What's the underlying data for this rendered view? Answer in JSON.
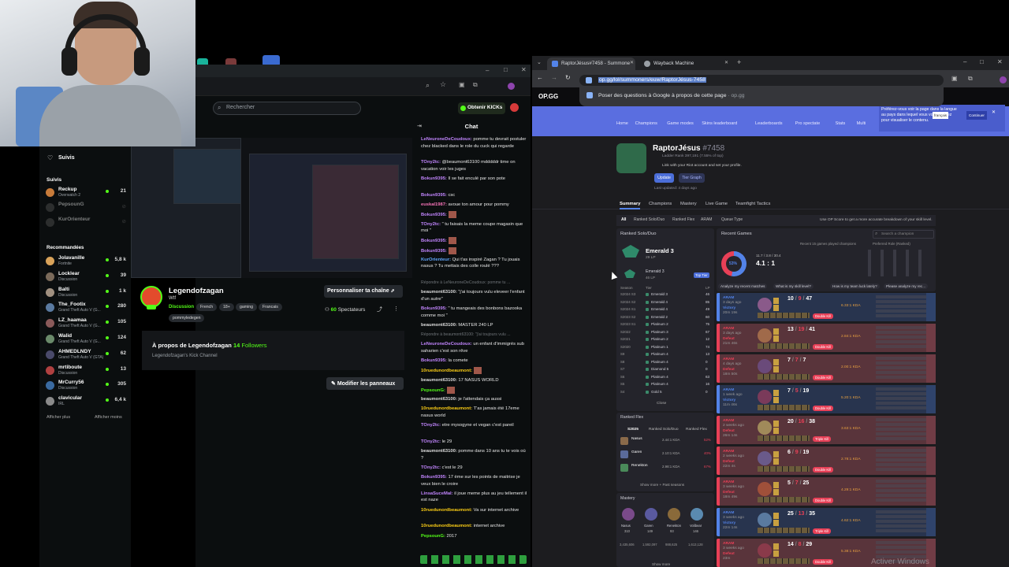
{
  "kick": {
    "search_placeholder": "Rechercher",
    "obtain_label": "Obtenir KICKs",
    "sidebar": {
      "following_title": "Suivis",
      "following_section": "Suivis",
      "following": [
        {
          "name": "Reckup",
          "sub": "Overwatch 2",
          "count": "21",
          "color": "#c77b3a"
        },
        {
          "name": "PepsounG",
          "sub": "",
          "count": "",
          "color": "#555"
        },
        {
          "name": "KurOrienteur",
          "sub": "",
          "count": "",
          "color": "#555"
        }
      ],
      "recommended_title": "Recommandées",
      "recommended": [
        {
          "name": "Jolavanille",
          "sub": "Fortnite",
          "count": "5,8 k",
          "color": "#d9a35a"
        },
        {
          "name": "Locklear",
          "sub": "Discussion",
          "count": "39",
          "color": "#7a6a5a"
        },
        {
          "name": "Balti",
          "sub": "Discussion",
          "count": "1 k",
          "color": "#a09080"
        },
        {
          "name": "The_Footix",
          "sub": "Grand Theft Auto V (G...",
          "count": "280",
          "color": "#5a7aa0"
        },
        {
          "name": "LZ_haamaa",
          "sub": "Grand Theft Auto V (G...",
          "count": "105",
          "color": "#8a5a5a"
        },
        {
          "name": "Walid",
          "sub": "Grand Theft Auto V (G...",
          "count": "124",
          "color": "#6a8a6a"
        },
        {
          "name": "AHMEDLNDY",
          "sub": "Grand Theft Auto V (GTA)",
          "count": "62",
          "color": "#4a4a6a"
        },
        {
          "name": "mrtiboute",
          "sub": "Discussion",
          "count": "13",
          "color": "#b04040"
        },
        {
          "name": "MrCurry56",
          "sub": "Discussion",
          "count": "305",
          "color": "#3a6aa0"
        },
        {
          "name": "clavicular",
          "sub": "IRL",
          "count": "6,4 k",
          "color": "#8a8a8a"
        }
      ],
      "show_more": "Afficher plus",
      "show_less": "Afficher moins"
    },
    "streamer": {
      "name": "Legendofzagan",
      "title": "Wtf",
      "category": "Discussion",
      "tags": [
        "French",
        "18+",
        "gaming",
        "Francais",
        "pommyledegen"
      ],
      "customize": "Personnaliser ta chaîne",
      "viewers": "60",
      "viewers_label": "Spectateurs",
      "about_prefix": "À propos de Legendofzagan",
      "followers": "14",
      "followers_label": "Followers",
      "channel_desc": "Legendofzagan's Kick Channel",
      "edit_panels": "Modifier les panneaux"
    },
    "chat": {
      "title": "Chat",
      "messages": [
        {
          "user": "LeNeuroneDeCoudoux:",
          "color": "#c084fc",
          "text": " pomme tu devrait postuler chez blacked dans le role du cuck qui regarde"
        },
        {
          "user": "TOny2tc:",
          "color": "#c084fc",
          "text": " @beaumont63100 mdddddr time on vacation voir les juges"
        },
        {
          "user": "Bokun9395:",
          "color": "#c084fc",
          "text": " Il se fait enculé par son pote"
        },
        {
          "user": "Bokun9395:",
          "color": "#c084fc",
          "text": " csc"
        },
        {
          "user": "euskal1987:",
          "color": "#f472b6",
          "text": " avoue ton amour pour pommy"
        },
        {
          "user": "Bokun9395:",
          "color": "#c084fc",
          "text": ""
        },
        {
          "user": "TOny2tc:",
          "color": "#c084fc",
          "text": " \" tu faisais la meme coupe magasin que moi \""
        },
        {
          "user": "Bokun9395:",
          "color": "#c084fc",
          "text": ""
        },
        {
          "user": "Bokun9395:",
          "color": "#c084fc",
          "text": ""
        },
        {
          "user": "KurOrienteur:",
          "color": "#60a5fa",
          "text": " Qui t'as inspiré Zagan ? Tu jouais nasus ? Tu mettais des colle roulé ???"
        },
        {
          "user": "",
          "color": "#6f7479",
          "text": "Répondre à LeNeuroneDeCoudoux: pomme tu ...",
          "reply": true
        },
        {
          "user": "beaumont63100:",
          "color": "#dddddd",
          "text": " \"j'ai toujours vulu eleveer l'enfant d'un autre\""
        },
        {
          "user": "Bokun9395:",
          "color": "#c084fc",
          "text": " \" tu mangeais des bonbons bazooka comme moi \""
        },
        {
          "user": "beaumont63100:",
          "color": "#dddddd",
          "text": " MASTER 240 LP"
        },
        {
          "user": "",
          "color": "#6f7479",
          "text": "Répondre à beaumont63100: \"j'ai toujours vulu ...",
          "reply": true
        },
        {
          "user": "LeNeuroneDeCoudoux:",
          "color": "#c084fc",
          "text": " un enfant d'immigrés sub saharien c'est son rêve"
        },
        {
          "user": "Bokun9395:",
          "color": "#c084fc",
          "text": " la comete"
        },
        {
          "user": "10ruedunordbeaumont:",
          "color": "#facc15",
          "text": ""
        },
        {
          "user": "beaumont63100:",
          "color": "#dddddd",
          "text": " 17 NASUS WORLD"
        },
        {
          "user": "PepsounG:",
          "color": "#53fc18",
          "text": ""
        },
        {
          "user": "beaumont63100:",
          "color": "#dddddd",
          "text": " je l'attendais ça aussi"
        },
        {
          "user": "10ruedunordbeaumont:",
          "color": "#facc15",
          "text": " T'as jamais été 17eme nasus world"
        },
        {
          "user": "TOny2tc:",
          "color": "#c084fc",
          "text": " etre mysogyne et vegan c'est pareil"
        },
        {
          "user": "TOny2tc:",
          "color": "#c084fc",
          "text": " le 29"
        },
        {
          "user": "beaumont63100:",
          "color": "#dddddd",
          "text": " pomme dans 10 ans tu te vois où ?"
        },
        {
          "user": "TOny2tc:",
          "color": "#c084fc",
          "text": " c'est le 29"
        },
        {
          "user": "Bokun9395:",
          "color": "#c084fc",
          "text": " 17 ème sur les points de maitrise je veux bien le croire"
        },
        {
          "user": "LinsaSuceMal:",
          "color": "#c084fc",
          "text": " il joue meme plus au jeu tellement il est naze"
        },
        {
          "user": "10ruedunordbeaumont:",
          "color": "#facc15",
          "text": " Va sur internet archive"
        },
        {
          "user": "10ruedunordbeaumont:",
          "color": "#facc15",
          "text": " internet archive"
        },
        {
          "user": "PepsounG:",
          "color": "#53fc18",
          "text": " 2017"
        }
      ]
    }
  },
  "browser": {
    "tabs": [
      {
        "label": "RaptorJésus#7458 - Summone",
        "active": true,
        "color": "#5383e8"
      },
      {
        "label": "Wayback Machine",
        "active": false,
        "color": "#9aa0a6"
      }
    ],
    "url": "op.gg/lol/summoners/euw/RaptorJésus-7458",
    "dropdown_text": "Poser des questions à Google à propos de cette page",
    "dropdown_domain": "· op.gg",
    "brand": "OP.GG",
    "subnav": [
      "Home",
      "Champions",
      "Game modes",
      "Skins leaderboard",
      "Leaderboards",
      "Pro spectate",
      "Stats",
      "Multi"
    ],
    "translate_lang": "français",
    "translate_btn": "Continuer",
    "translate_text": "Préférez-vous voir la page dans la langue au pays dans lequel vous vous trouvez pour visualiser le contenu."
  },
  "profile": {
    "name": "RaptorJésus",
    "tag": "#7458",
    "ladder": "Ladder Rank 397,191 (7.55% of top)",
    "link_text": "Link with your Riot account and set your profile.",
    "update": "Update",
    "tier_graph": "Tier Graph",
    "last_updated": "Last updated: 4 days ago",
    "tabs": [
      "Summary",
      "Champions",
      "Mastery",
      "Live Game",
      "Teamfight Tactics"
    ],
    "queue_tabs": [
      "All",
      "Ranked Solo/Duo",
      "Ranked Flex",
      "ARAM",
      "Queue Type"
    ],
    "score_hint": "Use OP Score to get a more accurate breakdown of your skill level.",
    "ranked_title": "Ranked Solo/Duo",
    "rank": "Emerald 3",
    "rank_lp": "29 LP",
    "rank2": "Emerald 3",
    "rank2_lp": "46 LP",
    "top_tier": "Top Tier",
    "season_col": "Season",
    "tier_col": "Tier",
    "lp_col": "LP",
    "seasons": [
      {
        "s": "S2024 S3",
        "t": "Emerald 3",
        "lp": "46"
      },
      {
        "s": "S2024 S2",
        "t": "Emerald 4",
        "lp": "85"
      },
      {
        "s": "S2024 S1",
        "t": "Emerald 4",
        "lp": "49"
      },
      {
        "s": "S2023 S2",
        "t": "Emerald 2",
        "lp": "60"
      },
      {
        "s": "S2023 S1",
        "t": "Platinum 2",
        "lp": "75"
      },
      {
        "s": "S2022",
        "t": "Platinum 3",
        "lp": "67"
      },
      {
        "s": "S2021",
        "t": "Platinum 2",
        "lp": "12"
      },
      {
        "s": "S2020",
        "t": "Platinum 1",
        "lp": "74"
      },
      {
        "s": "S9",
        "t": "Platinum 4",
        "lp": "13"
      },
      {
        "s": "S8",
        "t": "Platinum 4",
        "lp": "0"
      },
      {
        "s": "S7",
        "t": "Diamond 5",
        "lp": "0"
      },
      {
        "s": "S6",
        "t": "Platinum 4",
        "lp": "63"
      },
      {
        "s": "S5",
        "t": "Platinum 4",
        "lp": "16"
      },
      {
        "s": "S4",
        "t": "Gold 5",
        "lp": "0"
      }
    ],
    "close": "Close",
    "flex_title": "Ranked Flex",
    "flex_tabs": [
      "S2025",
      "Ranked Solo/Duo",
      "Ranked Flex"
    ],
    "flex_champs": [
      {
        "name": "Nasus",
        "kda": "2.44:1 KDA",
        "wr": "52%",
        "color": "#8a6a4a"
      },
      {
        "name": "Garen",
        "kda": "2.10:1 KDA",
        "wr": "40%",
        "color": "#5a6a9a"
      },
      {
        "name": "Renekton",
        "kda": "2.98:1 KDA",
        "wr": "67%",
        "color": "#4a8a5a"
      }
    ],
    "show_more_seasons": "Show more + Past seasons",
    "mastery_title": "Mastery",
    "mastery": [
      {
        "name": "Nasus",
        "level": "310",
        "pts": "3,435,606"
      },
      {
        "name": "Garen",
        "level": "149",
        "pts": "1,592,097"
      },
      {
        "name": "Renekton",
        "level": "93",
        "pts": "988,625"
      },
      {
        "name": "Volibear",
        "level": "146",
        "pts": "1,613,128"
      }
    ],
    "show_more": "Show more",
    "recent_title": "Recent Games",
    "search_champ": "Search a champion",
    "stat_summary": "Recent 15 games played champions",
    "winrate": "53%",
    "kda_ratio": "4.1 : 1",
    "kda_detail": "11.7 / 3.8 / 30.4",
    "pref_role": "Preferred Role (Ranked)",
    "analyze": [
      "Analyze my recent matches",
      "What is my skill level?",
      "How is my team luck lately?",
      "Please analyze my rec..."
    ],
    "games": [
      {
        "mode": "ARAM",
        "ago": "3 days ago",
        "result": "Victory",
        "dur": "20m 19s",
        "k": "10",
        "d": "9",
        "a": "47",
        "kdr": "6.33:1 KDA",
        "badge": "Double Kill",
        "win": true
      },
      {
        "mode": "ARAM",
        "ago": "3 days ago",
        "result": "Defeat",
        "dur": "21m 46s",
        "k": "13",
        "d": "19",
        "a": "41",
        "kdr": "2.84:1 KDA",
        "badge": "Double Kill",
        "win": false
      },
      {
        "mode": "ARAM",
        "ago": "4 days ago",
        "result": "Defeat",
        "dur": "18m 50s",
        "k": "7",
        "d": "7",
        "a": "7",
        "kdr": "2.00:1 KDA",
        "badge": "Double Kill",
        "win": false
      },
      {
        "mode": "ARAM",
        "ago": "1 week ago",
        "result": "Victory",
        "dur": "11m 46s",
        "k": "7",
        "d": "5",
        "a": "19",
        "kdr": "5.20:1 KDA",
        "badge": "Double Kill",
        "win": true
      },
      {
        "mode": "ARAM",
        "ago": "2 weeks ago",
        "result": "Defeat",
        "dur": "26m 14s",
        "k": "20",
        "d": "16",
        "a": "38",
        "kdr": "3.63:1 KDA",
        "badge": "Triple Kill",
        "win": false
      },
      {
        "mode": "ARAM",
        "ago": "2 weeks ago",
        "result": "Defeat",
        "dur": "22m 4s",
        "k": "6",
        "d": "9",
        "a": "19",
        "kdr": "2.78:1 KDA",
        "badge": "Double Kill",
        "win": false
      },
      {
        "mode": "ARAM",
        "ago": "3 weeks ago",
        "result": "Defeat",
        "dur": "18m 49s",
        "k": "5",
        "d": "7",
        "a": "25",
        "kdr": "4.29:1 KDA",
        "badge": "Double Kill",
        "win": false
      },
      {
        "mode": "ARAM",
        "ago": "3 weeks ago",
        "result": "Victory",
        "dur": "22m 14s",
        "k": "25",
        "d": "13",
        "a": "35",
        "kdr": "4.62:1 KDA",
        "badge": "Triple Kill",
        "win": true
      },
      {
        "mode": "ARAM",
        "ago": "3 weeks ago",
        "result": "Defeat",
        "dur": "23m",
        "k": "14",
        "d": "8",
        "a": "29",
        "kdr": "5.38:1 KDA",
        "badge": "Double Kill",
        "win": false
      }
    ]
  },
  "watermark": "Activer Windows"
}
